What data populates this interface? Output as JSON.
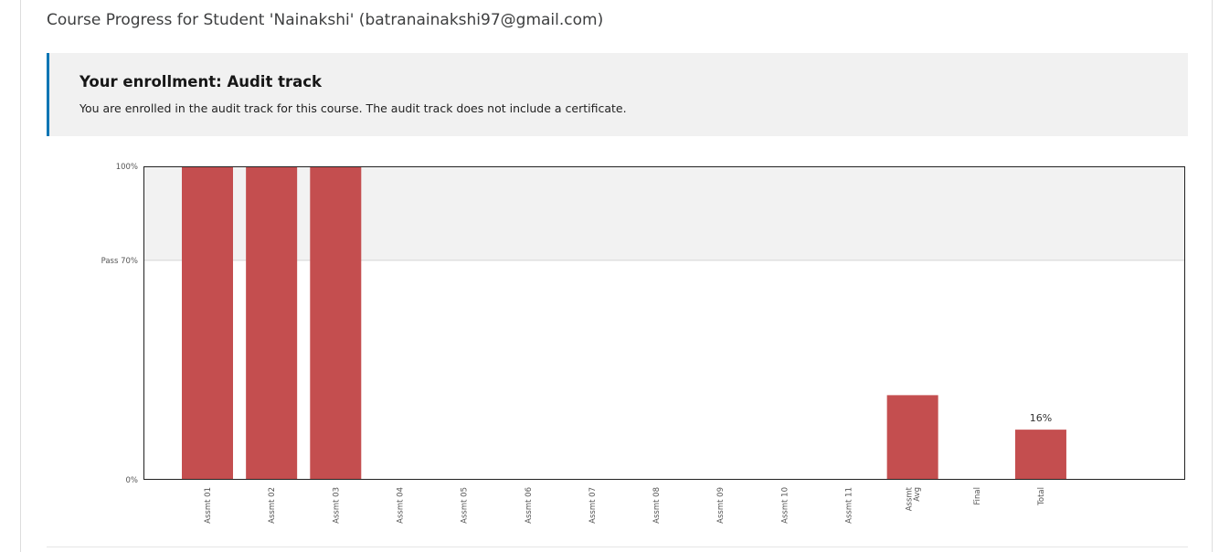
{
  "page": {
    "title": "Course Progress for Student 'Nainakshi' (batranainakshi97@gmail.com)"
  },
  "enrollment": {
    "title": "Your enrollment: Audit track",
    "message": "You are enrolled in the audit track for this course. The audit track does not include a certificate."
  },
  "colors": {
    "bar": "#c44e4f",
    "pass_band": "#f2f2f2",
    "accent_border": "#0075b4"
  },
  "chart_data": {
    "type": "bar",
    "title": "",
    "xlabel": "",
    "ylabel": "",
    "ylim": [
      0,
      100
    ],
    "y_ticks": [
      {
        "value": 0,
        "label": "0%"
      },
      {
        "value": 70,
        "label": "Pass 70%"
      },
      {
        "value": 100,
        "label": "100%"
      }
    ],
    "pass_threshold": 70,
    "categories": [
      [
        "Assmt 01"
      ],
      [
        "Assmt 02"
      ],
      [
        "Assmt 03"
      ],
      [
        "Assmt 04"
      ],
      [
        "Assmt 05"
      ],
      [
        "Assmt 06"
      ],
      [
        "Assmt 07"
      ],
      [
        "Assmt 08"
      ],
      [
        "Assmt 09"
      ],
      [
        "Assmt 10"
      ],
      [
        "Assmt 11"
      ],
      [
        "Assmt",
        "Avg"
      ],
      [
        "Final"
      ],
      [
        "Total"
      ]
    ],
    "values": [
      100,
      100,
      100,
      0,
      0,
      0,
      0,
      0,
      0,
      0,
      0,
      27,
      0,
      16
    ],
    "data_labels": [
      {
        "index": 13,
        "text": "16%"
      }
    ]
  }
}
